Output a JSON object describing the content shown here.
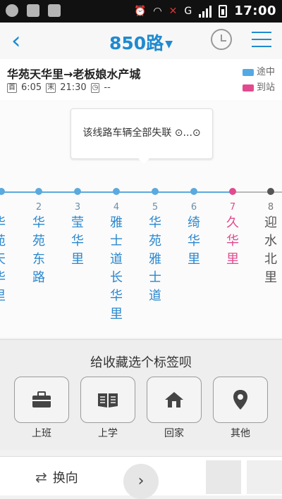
{
  "status_bar": {
    "time": "17:00",
    "network": "G"
  },
  "header": {
    "title": "850路",
    "back_icon": "chevron-left-icon",
    "alarm_icon": "alarm-clock-icon",
    "menu_icon": "menu-icon",
    "accent": "#1f8ad1"
  },
  "route": {
    "title": "华苑天华里→老板娘水产城",
    "first_label": "首",
    "first_time": "6:05",
    "last_label": "末",
    "last_time": "21:30",
    "interval_text": "--",
    "legend_enroute": "途中",
    "legend_arrived": "到站"
  },
  "notice": {
    "text": "该线路车辆全部失联 ⊙...⊙"
  },
  "stops": [
    {
      "num": "",
      "name": "华苑天华里",
      "color": "#2b88cf"
    },
    {
      "num": "2",
      "name": "华苑东路",
      "color": "#2b88cf"
    },
    {
      "num": "3",
      "name": "莹华里",
      "color": "#2b88cf"
    },
    {
      "num": "4",
      "name": "雅士道长华里",
      "color": "#2b88cf"
    },
    {
      "num": "5",
      "name": "华苑雅士道",
      "color": "#2b88cf"
    },
    {
      "num": "6",
      "name": "绮华里",
      "color": "#2b88cf"
    },
    {
      "num": "7",
      "name": "久华里",
      "color": "#e24a8f"
    },
    {
      "num": "8",
      "name": "迎水北里",
      "color": "#555555"
    }
  ],
  "favorites": {
    "title": "给收藏选个标签呗",
    "tags": [
      {
        "label": "上班",
        "icon": "briefcase-icon"
      },
      {
        "label": "上学",
        "icon": "book-icon"
      },
      {
        "label": "回家",
        "icon": "home-icon"
      },
      {
        "label": "其他",
        "icon": "location-pin-icon"
      }
    ]
  },
  "bottom_bar": {
    "switch_label": "换向",
    "switch_icon": "swap-arrows-icon",
    "more_icon": "chevron-right-icon"
  }
}
